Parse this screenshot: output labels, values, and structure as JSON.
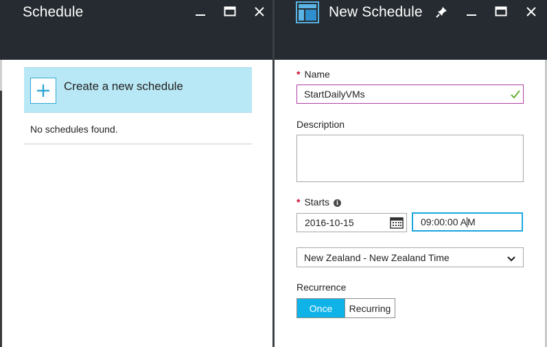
{
  "left_blade": {
    "title": "Schedule",
    "create_label": "Create a new schedule",
    "empty_message": "No schedules found."
  },
  "right_blade": {
    "title": "New Schedule",
    "form": {
      "required_mark": "*",
      "name_label": "Name",
      "name_value": "StartDailyVMs",
      "description_label": "Description",
      "description_value": "",
      "starts_label": "Starts",
      "starts_info": "i",
      "date_value": "2016-10-15",
      "time_value_before_caret": "09:00:00 A",
      "time_value_after_caret": "M",
      "timezone_value": "New Zealand - New Zealand Time",
      "recurrence_label": "Recurrence",
      "recurrence_options": [
        "Once",
        "Recurring"
      ],
      "recurrence_selected": "Once"
    }
  },
  "icons": {
    "minimize": "minimize-icon",
    "maximize": "maximize-icon",
    "close": "close-icon",
    "pin": "pin-icon",
    "blade": "blade-icon",
    "plus": "plus-icon",
    "check": "checkmark-icon",
    "calendar": "calendar-icon",
    "chevron": "chevron-down-icon",
    "info": "info-icon"
  },
  "colors": {
    "header_bg": "#252b30",
    "tile_bg": "#b8e8f5",
    "accent": "#19a6dd",
    "selected_toggle": "#10b3e8",
    "required": "#c8102e",
    "valid_check": "#6cb33e",
    "name_border": "#b03fa0"
  }
}
